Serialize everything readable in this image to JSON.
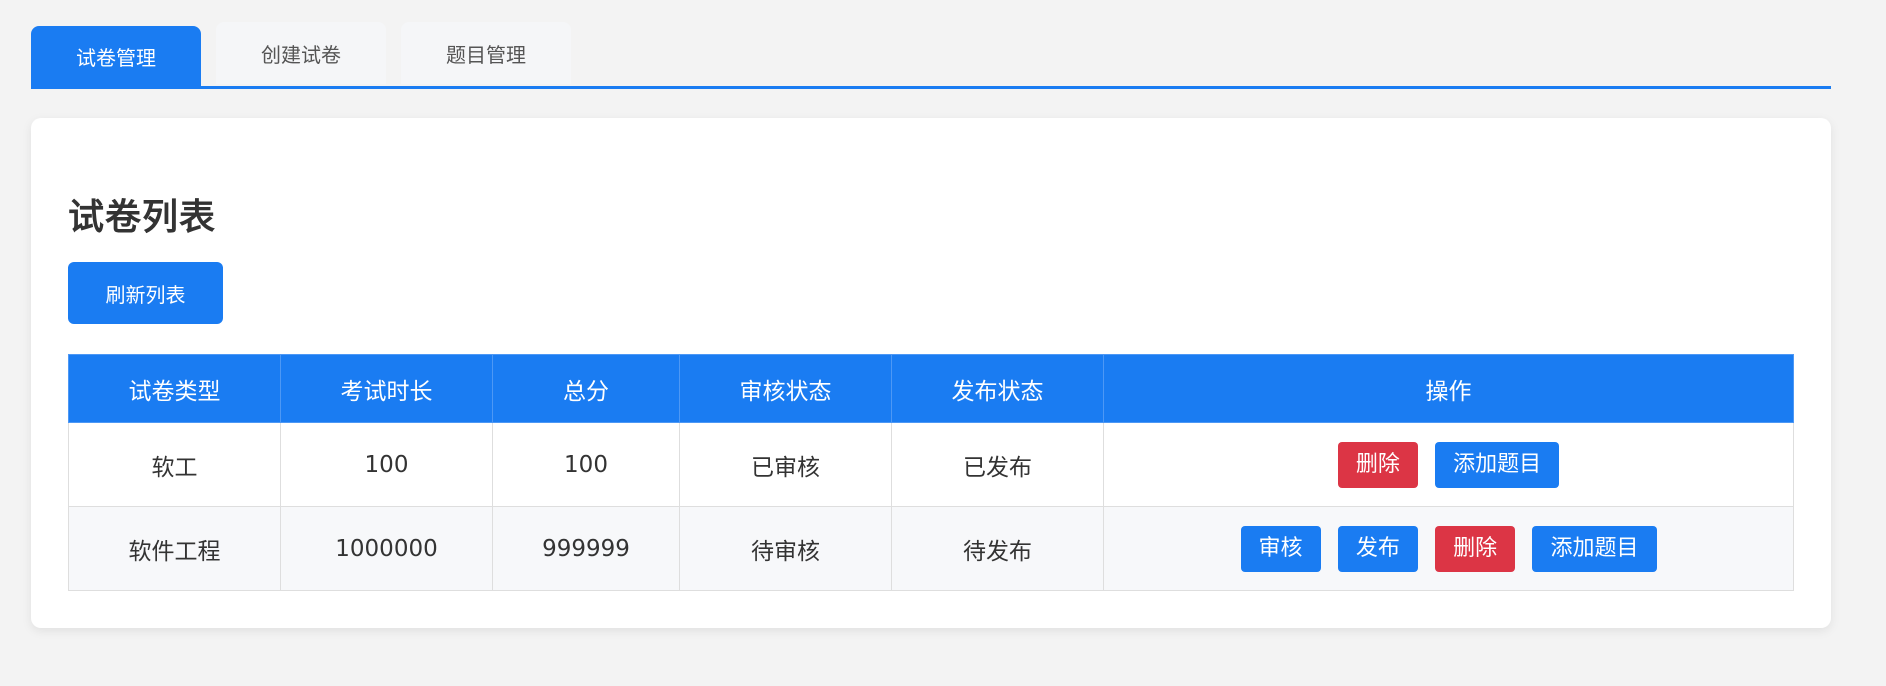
{
  "tabs": [
    {
      "label": "试卷管理",
      "active": true
    },
    {
      "label": "创建试卷",
      "active": false
    },
    {
      "label": "题目管理",
      "active": false
    }
  ],
  "card": {
    "title": "试卷列表",
    "refresh_label": "刷新列表"
  },
  "table": {
    "headers": [
      "试卷类型",
      "考试时长",
      "总分",
      "审核状态",
      "发布状态",
      "操作"
    ],
    "rows": [
      {
        "type": "软工",
        "duration": "100",
        "score": "100",
        "review_status": "已审核",
        "publish_status": "已发布",
        "actions": [
          {
            "label": "删除",
            "color": "#dc3545"
          },
          {
            "label": "添加题目",
            "color": "#1a7cf2"
          }
        ]
      },
      {
        "type": "软件工程",
        "duration": "1000000",
        "score": "999999",
        "review_status": "待审核",
        "publish_status": "待发布",
        "actions": [
          {
            "label": "审核",
            "color": "#1a7cf2"
          },
          {
            "label": "发布",
            "color": "#1a7cf2"
          },
          {
            "label": "删除",
            "color": "#dc3545"
          },
          {
            "label": "添加题目",
            "color": "#1a7cf2"
          }
        ]
      }
    ]
  },
  "colors": {
    "primary": "#1a7cf2",
    "danger": "#dc3545",
    "background": "#f3f3f3"
  }
}
